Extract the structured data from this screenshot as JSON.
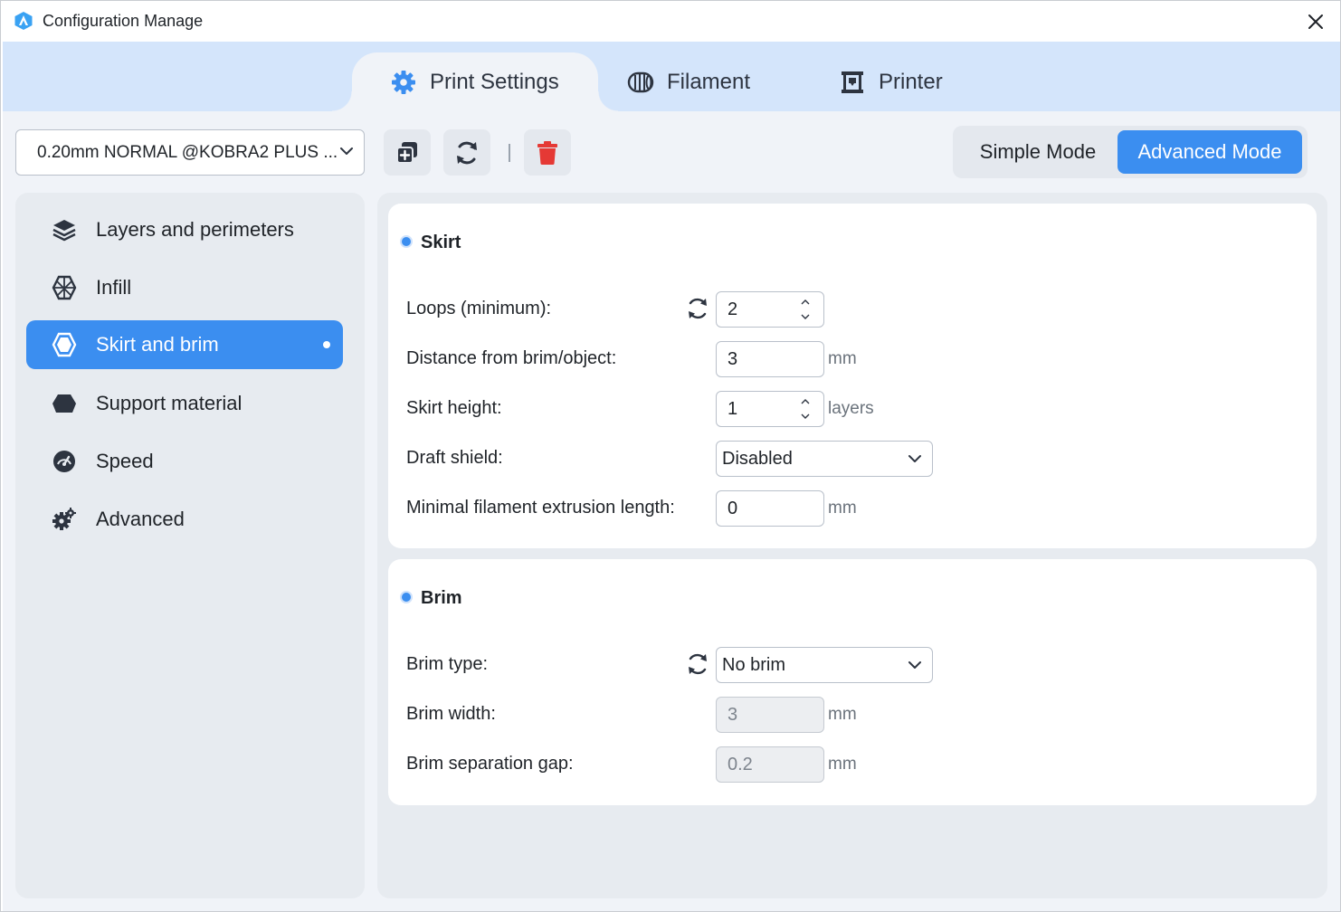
{
  "window": {
    "title": "Configuration Manage"
  },
  "tabs": [
    {
      "label": "Print Settings",
      "icon": "gear-icon",
      "active": true
    },
    {
      "label": "Filament",
      "icon": "filament-spool-icon",
      "active": false
    },
    {
      "label": "Printer",
      "icon": "printer-icon",
      "active": false
    }
  ],
  "toolbar": {
    "preset_value": "0.20mm NORMAL @KOBRA2 PLUS ...",
    "copy_icon": "copy-add-icon",
    "reset_icon": "refresh-icon",
    "delete_icon": "trash-icon"
  },
  "mode": {
    "simple_label": "Simple Mode",
    "advanced_label": "Advanced Mode",
    "selected": "Advanced Mode"
  },
  "sidebar": {
    "items": [
      {
        "label": "Layers and perimeters",
        "icon": "layers-icon"
      },
      {
        "label": "Infill",
        "icon": "infill-icon"
      },
      {
        "label": "Skirt and brim",
        "icon": "skirt-icon",
        "active": true
      },
      {
        "label": "Support material",
        "icon": "support-icon"
      },
      {
        "label": "Speed",
        "icon": "speedometer-icon"
      },
      {
        "label": "Advanced",
        "icon": "gears-icon"
      }
    ]
  },
  "skirt": {
    "title": "Skirt",
    "loops_label": "Loops (minimum):",
    "loops_value": "2",
    "distance_label": "Distance from brim/object:",
    "distance_value": "3",
    "distance_unit": "mm",
    "height_label": "Skirt height:",
    "height_value": "1",
    "height_unit": "layers",
    "draft_label": "Draft shield:",
    "draft_value": "Disabled",
    "minfil_label": "Minimal filament extrusion length:",
    "minfil_value": "0",
    "minfil_unit": "mm"
  },
  "brim": {
    "title": "Brim",
    "type_label": "Brim type:",
    "type_value": "No brim",
    "width_label": "Brim width:",
    "width_value": "3",
    "width_unit": "mm",
    "gap_label": "Brim separation gap:",
    "gap_value": "0.2",
    "gap_unit": "mm"
  },
  "colors": {
    "accent": "#3b8ef0",
    "tab_strip": "#d4e5fb",
    "panel_bg": "#f0f3f8",
    "delete": "#e53935"
  }
}
